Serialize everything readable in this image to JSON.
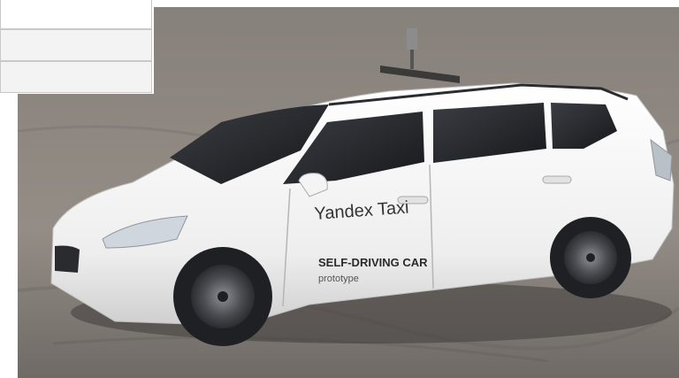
{
  "photo": {
    "decal": {
      "brand": "Yandex Taxi",
      "headline": "SELF-DRIVING CAR",
      "subline": "prototype"
    }
  },
  "overlay_panel": {
    "fields": [
      {
        "value": ""
      },
      {
        "value": ""
      },
      {
        "value": ""
      }
    ]
  }
}
